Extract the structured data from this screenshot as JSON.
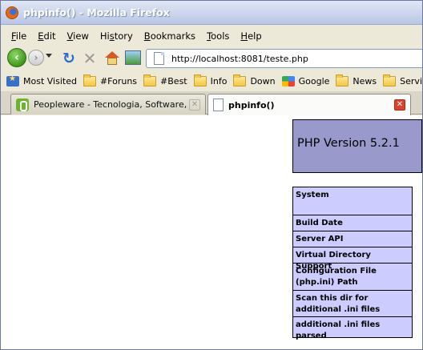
{
  "window": {
    "title": "phpinfo() - Mozilla Firefox"
  },
  "menubar": {
    "items": [
      {
        "label_pre": "",
        "accel": "F",
        "label_post": "ile"
      },
      {
        "label_pre": "",
        "accel": "E",
        "label_post": "dit"
      },
      {
        "label_pre": "",
        "accel": "V",
        "label_post": "iew"
      },
      {
        "label_pre": "Hi",
        "accel": "s",
        "label_post": "tory"
      },
      {
        "label_pre": "",
        "accel": "B",
        "label_post": "ookmarks"
      },
      {
        "label_pre": "",
        "accel": "T",
        "label_post": "ools"
      },
      {
        "label_pre": "",
        "accel": "H",
        "label_post": "elp"
      }
    ]
  },
  "navbar": {
    "url": "http://localhost:8081/teste.php",
    "icons": [
      "back-icon",
      "forward-icon",
      "history-dropdown-icon",
      "reload-icon",
      "stop-icon",
      "home-icon",
      "image-icon",
      "page-icon"
    ]
  },
  "bookmarks": {
    "items": [
      {
        "label": "Most Visited",
        "icon": "most-visited-icon"
      },
      {
        "label": "#Foruns",
        "icon": "folder-icon"
      },
      {
        "label": "#Best",
        "icon": "folder-icon"
      },
      {
        "label": "Info",
        "icon": "folder-icon"
      },
      {
        "label": "Down",
        "icon": "folder-icon"
      },
      {
        "label": "Google",
        "icon": "google-icon"
      },
      {
        "label": "News",
        "icon": "folder-icon"
      },
      {
        "label": "Services",
        "icon": "folder-icon"
      }
    ]
  },
  "tabs": [
    {
      "label": "Peopleware - Tecnologia, Software, Tu...",
      "active": false
    },
    {
      "label": "phpinfo()",
      "active": true
    }
  ],
  "content": {
    "php_version": "PHP Version 5.2.1",
    "rows": [
      "System",
      "Build Date",
      "Server API",
      "Virtual Directory Support",
      "Configuration File (php.ini) Path",
      "Scan this dir for additional .ini files",
      "additional .ini files parsed"
    ]
  },
  "colors": {
    "php_header_bg": "#9999cc",
    "php_row_bg": "#ccccff",
    "active_close": "#d9442e"
  }
}
